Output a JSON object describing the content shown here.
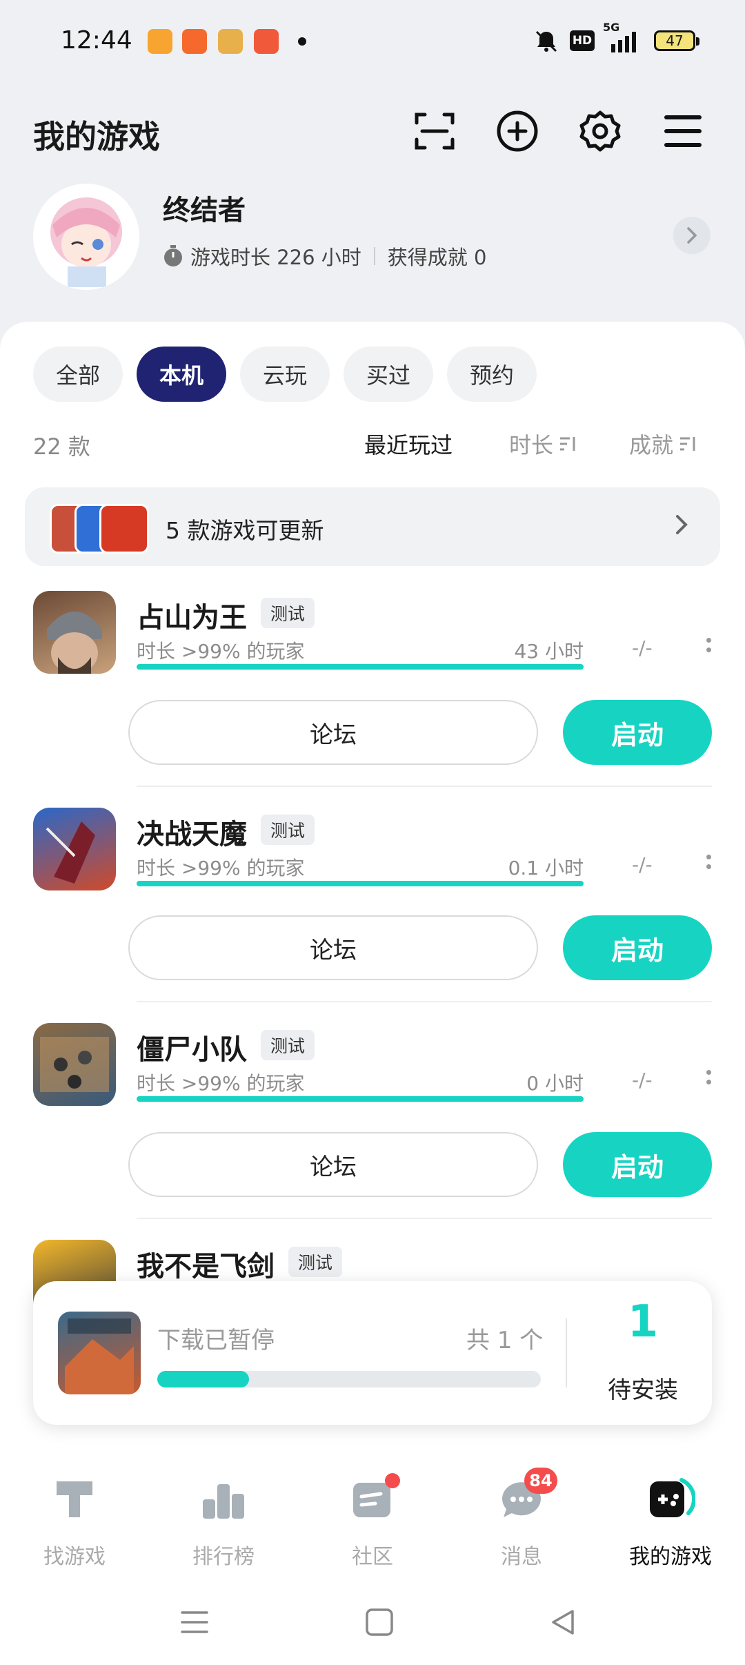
{
  "status_bar": {
    "time": "12:44",
    "network": "5G",
    "hd_label": "HD",
    "battery": "47",
    "app_icons": [
      {
        "name": "video-app-icon",
        "color": "#f7a530"
      },
      {
        "name": "shop-app-icon",
        "color": "#f56a2c"
      },
      {
        "name": "news-app-icon",
        "color": "#e8b04a"
      },
      {
        "name": "game-app-icon",
        "color": "#f05a3a"
      }
    ]
  },
  "header": {
    "title": "我的游戏",
    "icons": [
      "scan-icon",
      "add-circle-icon",
      "settings-gear-icon",
      "menu-icon"
    ]
  },
  "profile": {
    "username": "终结者",
    "playtime_label": "游戏时长 226 小时",
    "achievements_label": "获得成就 0"
  },
  "filter_tabs": [
    {
      "label": "全部",
      "active": false
    },
    {
      "label": "本机",
      "active": true
    },
    {
      "label": "云玩",
      "active": false
    },
    {
      "label": "买过",
      "active": false
    },
    {
      "label": "预约",
      "active": false
    }
  ],
  "list_header": {
    "count": "22 款",
    "sort_recent": "最近玩过",
    "sort_duration": "时长",
    "sort_achievement": "成就"
  },
  "update_banner": {
    "text": "5 款游戏可更新",
    "icon_colors": [
      "#c8503a",
      "#2f6fd6",
      "#d73a24"
    ]
  },
  "games": [
    {
      "name": "占山为王",
      "tag": "测试",
      "meta": "时长 >99% 的玩家",
      "hours": "43 小时",
      "achievement": "-/-",
      "forum": "论坛",
      "launch": "启动",
      "icon_colors": [
        "#6b4a36",
        "#c9a27c"
      ]
    },
    {
      "name": "决战天魔",
      "tag": "测试",
      "meta": "时长 >99% 的玩家",
      "hours": "0.1 小时",
      "achievement": "-/-",
      "forum": "论坛",
      "launch": "启动",
      "icon_colors": [
        "#2a68c8",
        "#d04a2a"
      ]
    },
    {
      "name": "僵尸小队",
      "tag": "测试",
      "meta": "时长 >99% 的玩家",
      "hours": "0 小时",
      "achievement": "-/-",
      "forum": "论坛",
      "launch": "启动",
      "icon_colors": [
        "#8a6a44",
        "#3a5a7a"
      ]
    },
    {
      "name": "我不是飞剑",
      "tag": "测试",
      "icon_colors": [
        "#f2b62a",
        "#3a3a3a"
      ]
    }
  ],
  "download": {
    "status": "下载已暂停",
    "total": "共 1 个",
    "progress": 0.24,
    "pending_count": "1",
    "pending_label": "待安装",
    "icon_colors": [
      "#c85a2e",
      "#3a6a8a"
    ]
  },
  "bottom_nav": [
    {
      "label": "找游戏",
      "icon": "find-game-icon",
      "active": false
    },
    {
      "label": "排行榜",
      "icon": "ranking-icon",
      "active": false
    },
    {
      "label": "社区",
      "icon": "community-icon",
      "active": false,
      "dot": true
    },
    {
      "label": "消息",
      "icon": "message-icon",
      "active": false,
      "badge": "84"
    },
    {
      "label": "我的游戏",
      "icon": "my-games-icon",
      "active": true
    }
  ],
  "system_nav": [
    "recent-apps-icon",
    "home-icon",
    "back-icon"
  ],
  "colors": {
    "accent": "#17d4c2",
    "tab_active": "#1f2372",
    "badge": "#f44c4c"
  }
}
